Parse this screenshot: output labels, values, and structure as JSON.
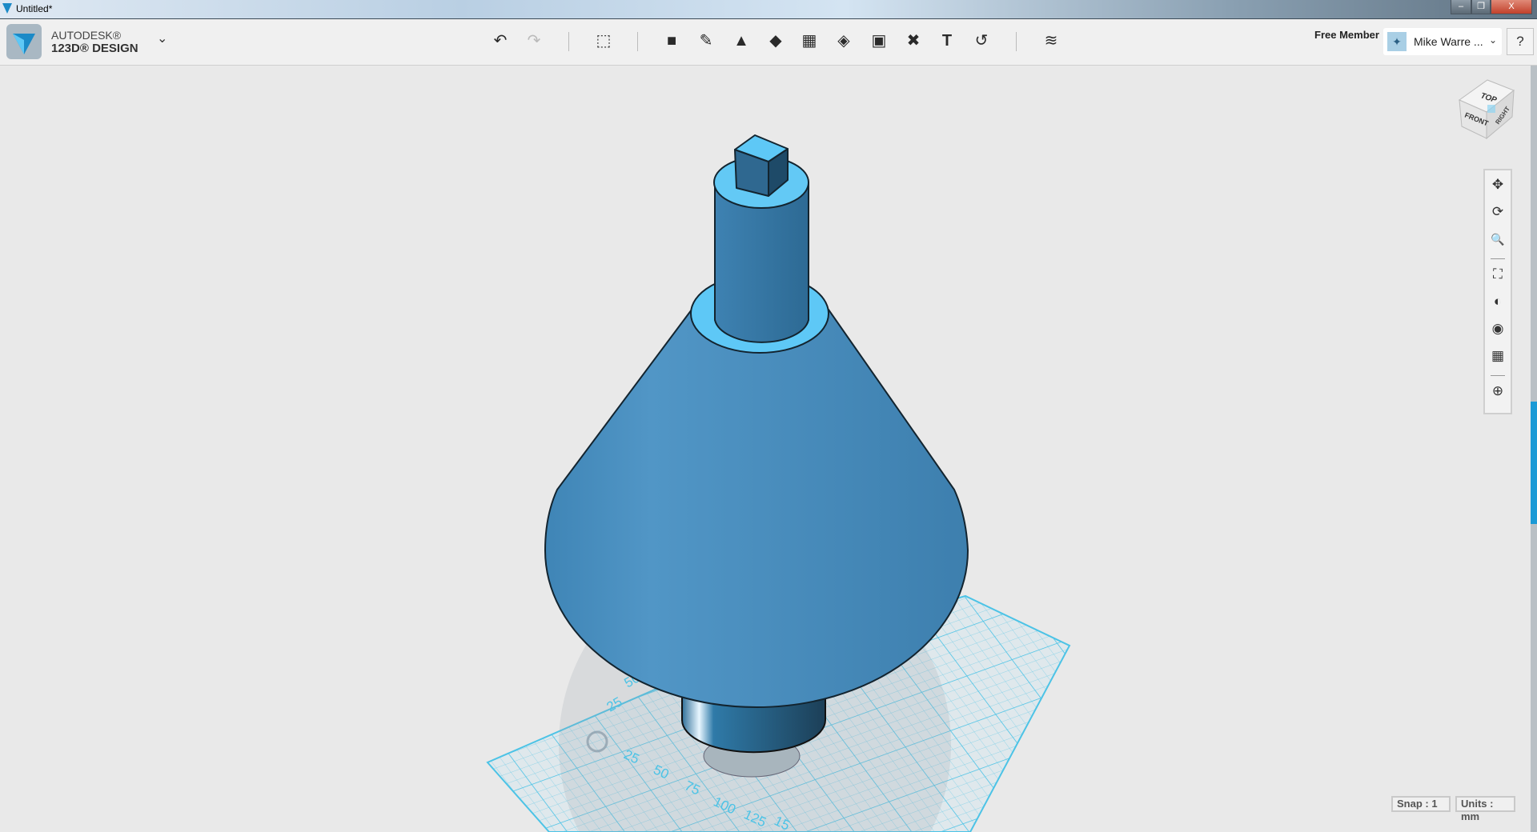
{
  "window": {
    "title": "Untitled*",
    "minimize": "–",
    "restore": "❐",
    "close": "X"
  },
  "app": {
    "brand_top": "AUTODESK®",
    "brand_name": "123D® DESIGN",
    "menu_chevron": "⌄"
  },
  "toolbar": {
    "tools": [
      {
        "name": "undo-button",
        "icon": "↶"
      },
      {
        "name": "redo-button",
        "icon": "↷"
      },
      {
        "name": "transform-button",
        "icon": "⬚"
      },
      {
        "name": "primitives-button",
        "icon": "■"
      },
      {
        "name": "sketch-button",
        "icon": "✎"
      },
      {
        "name": "construct-button",
        "icon": "▲"
      },
      {
        "name": "modify-button",
        "icon": "◆"
      },
      {
        "name": "pattern-button",
        "icon": "▦"
      },
      {
        "name": "group-button",
        "icon": "◈"
      },
      {
        "name": "combine-button",
        "icon": "▣"
      },
      {
        "name": "measure-button",
        "icon": "✖"
      },
      {
        "name": "text-button",
        "icon": "T"
      },
      {
        "name": "snap-button",
        "icon": "↺"
      },
      {
        "name": "material-button",
        "icon": "≋"
      }
    ]
  },
  "account": {
    "membership": "Free Member",
    "user": "Mike Warre ...",
    "help": "?"
  },
  "viewcube": {
    "top": "TOP",
    "front": "FRONT",
    "right": "RIGHT"
  },
  "nav": [
    {
      "name": "pan",
      "icon": "✥"
    },
    {
      "name": "orbit",
      "icon": "⟳"
    },
    {
      "name": "zoom",
      "icon": "🔍"
    },
    {
      "name": "fit",
      "icon": "⛶"
    },
    {
      "name": "views",
      "icon": "◐"
    },
    {
      "name": "visibility",
      "icon": "◉"
    },
    {
      "name": "grid-visibility",
      "icon": "▦"
    },
    {
      "name": "material",
      "icon": "⊕"
    }
  ],
  "grid": {
    "x_labels": [
      "25",
      "50",
      "75",
      "100",
      "125",
      "15"
    ],
    "y_labels": [
      "25",
      "50"
    ]
  },
  "status": {
    "snap": "Snap : 1",
    "units": "Units : mm"
  },
  "colors": {
    "body": "#4a8fc0",
    "highlight": "#5ec8f6",
    "grid": "#4cc3e6"
  }
}
